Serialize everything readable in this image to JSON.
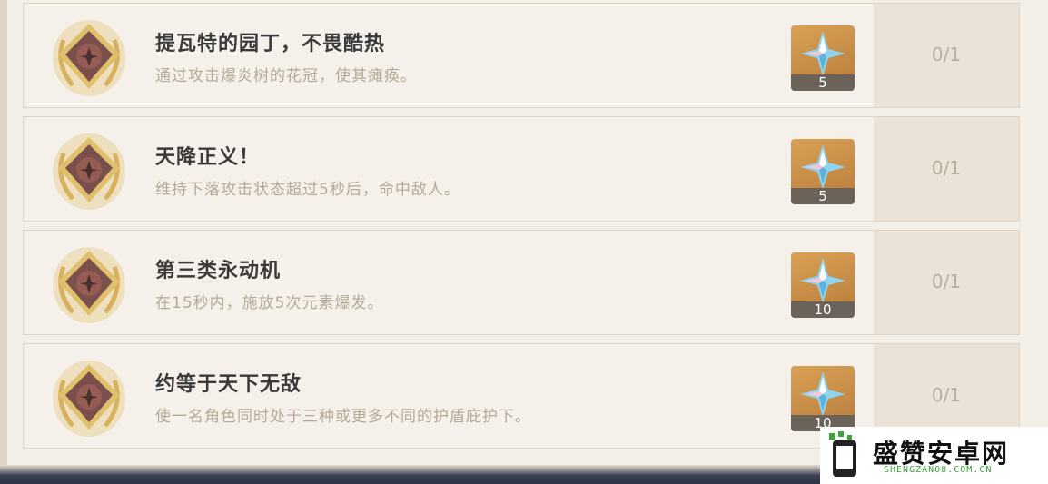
{
  "achievements": [
    {
      "title": "提瓦特的园丁，不畏酷热",
      "desc": "通过攻击爆炎树的花冠，使其瘫痪。",
      "reward_qty": "5",
      "progress": "0/1"
    },
    {
      "title": "天降正义！",
      "desc": "维持下落攻击状态超过5秒后，命中敌人。",
      "reward_qty": "5",
      "progress": "0/1"
    },
    {
      "title": "第三类永动机",
      "desc": "在15秒内，施放5次元素爆发。",
      "reward_qty": "10",
      "progress": "0/1"
    },
    {
      "title": "约等于天下无敌",
      "desc": "使一名角色同时处于三种或更多不同的护盾庇护下。",
      "reward_qty": "10",
      "progress": "0/1"
    }
  ],
  "reward_icon": "primogem-icon",
  "watermark": {
    "cn": "盛赞安卓网",
    "en": "SHENGZAN08.COM.CN"
  },
  "colors": {
    "accent_gold": "#d8b15e",
    "reward_bg": "#c98b43"
  }
}
